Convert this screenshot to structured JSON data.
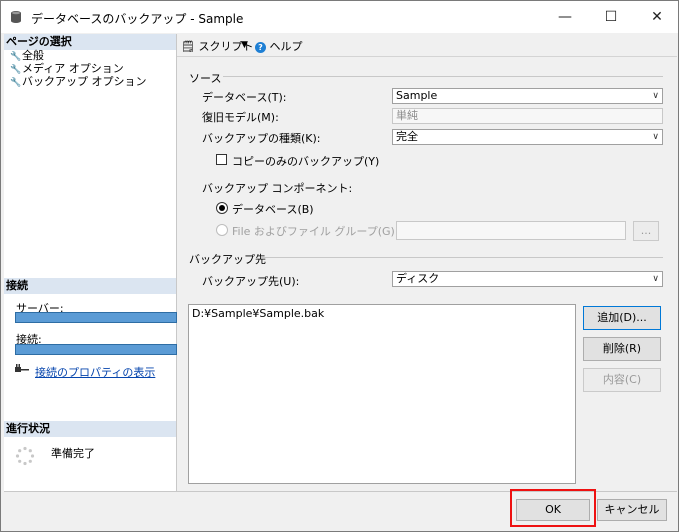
{
  "window": {
    "title": "データベースのバックアップ - Sample",
    "min_glyph": "—",
    "max_glyph": "☐",
    "close_glyph": "✕"
  },
  "sidebar": {
    "pages_header": "ページの選択",
    "items": [
      {
        "label": "全般"
      },
      {
        "label": "メディア オプション"
      },
      {
        "label": "バックアップ オプション"
      }
    ],
    "connection_header": "接続",
    "server_label": "サーバー:",
    "connection_label": "接続:",
    "properties_link": "接続のプロパティの表示",
    "progress_header": "進行状況",
    "progress_status": "準備完了"
  },
  "toolbar": {
    "script_label": "スクリプト",
    "help_label": "ヘルプ"
  },
  "source": {
    "group_label": "ソース",
    "database_label": "データベース(T):",
    "database_value": "Sample",
    "recovery_label": "復旧モデル(M):",
    "recovery_value": "単純",
    "backup_type_label": "バックアップの種類(K):",
    "backup_type_value": "完全",
    "copy_only_label": "コピーのみのバックアップ(Y)",
    "component_label": "バックアップ コンポーネント:",
    "radio_database": "データベース(B)",
    "radio_files": "File およびファイル グループ(G):",
    "browse_label": "..."
  },
  "destination": {
    "group_label": "バックアップ先",
    "dest_label": "バックアップ先(U):",
    "dest_value": "ディスク",
    "paths": [
      "D:¥Sample¥Sample.bak"
    ],
    "add_button": "追加(D)...",
    "remove_button": "削除(R)",
    "contents_button": "内容(C)"
  },
  "footer": {
    "ok_button": "OK",
    "cancel_button": "キャンセル"
  },
  "colors": {
    "connection_bar": "#5b9bd5",
    "section_header": "#dbe5f1",
    "highlight": "#ee1111"
  }
}
